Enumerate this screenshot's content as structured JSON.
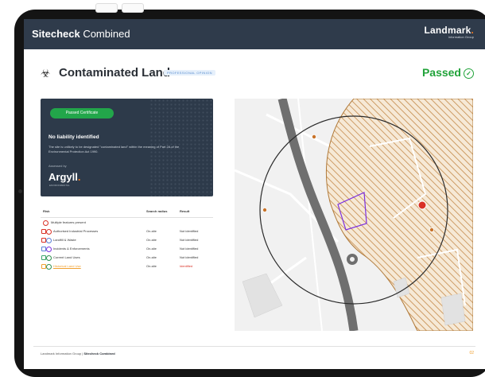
{
  "app": {
    "title_bold": "Sitecheck",
    "title_rest": " Combined"
  },
  "brand": {
    "name": "Landmark",
    "dot": ".",
    "subtitle": "Information Group"
  },
  "page": {
    "title": "Contaminated Land",
    "badge": "PROFESSIONAL OPINION",
    "status": "Passed",
    "status_icon": "check-circle-icon"
  },
  "certificate": {
    "button_label": "Passed Certificate",
    "heading": "No liability identified",
    "text": "The site is unlikely to be designated \"contaminated land\" within the meaning of Part 2A of the Environmental Protection Act 1990.",
    "assessed_by": "Assessed by",
    "assessor": "Argyll",
    "assessor_dot": ".",
    "assessor_sub": "ENVIRONMENTAL"
  },
  "risk_table": {
    "headers": {
      "risk": "Risk",
      "radius": "Search radius",
      "result": "Result"
    },
    "rows": [
      {
        "risk": "Multiple features present",
        "radius": "",
        "result": "",
        "result_color": "#333333"
      },
      {
        "risk": "Authorised Industrial Processes",
        "radius": "On-site",
        "result": "Not identified",
        "result_color": "#333333"
      },
      {
        "risk": "Landfill & Waste",
        "radius": "On-site",
        "result": "Not identified",
        "result_color": "#333333"
      },
      {
        "risk": "Incidents & Enforcements",
        "radius": "On-site",
        "result": "Not identified",
        "result_color": "#333333"
      },
      {
        "risk": "Current Land Uses",
        "radius": "On-site",
        "result": "Not identified",
        "result_color": "#333333"
      },
      {
        "risk": "Historical Land Use",
        "radius": "On-site",
        "result": "Identified",
        "result_color": "#d93025"
      }
    ]
  },
  "footer": {
    "org": "Landmark Information Group",
    "sep": " | ",
    "product": "Sitecheck Combined",
    "page_number": "02"
  },
  "colors": {
    "topbar": "#2f3b4b",
    "accent": "#f47a20",
    "pass": "#21a33a",
    "card": "#2d3a4a",
    "site_boundary": "#7a2ee0"
  }
}
